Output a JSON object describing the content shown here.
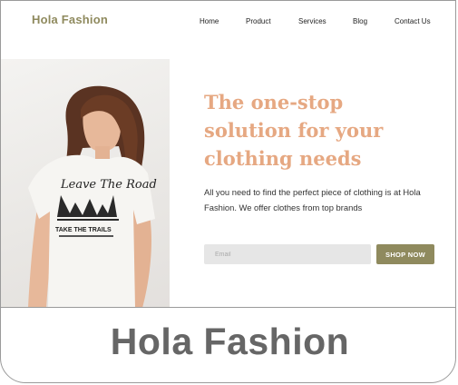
{
  "brand": {
    "logo": "Hola Fashion",
    "accent": "#8f8a5e",
    "headline_color": "#e6a882"
  },
  "nav": {
    "items": [
      "Home",
      "Product",
      "Services",
      "Blog",
      "Contact Us"
    ]
  },
  "hero": {
    "title": "The one-stop solution for your clothing needs",
    "text": "All you need to find the perfect piece of clothing is at Hola Fashion. We offer clothes from top brands",
    "email_placeholder": "Email",
    "cta": "SHOP NOW",
    "shirt_text_top": "Leave The Road",
    "shirt_text_bottom": "TAKE THE TRAILS"
  },
  "caption": "Hola Fashion"
}
